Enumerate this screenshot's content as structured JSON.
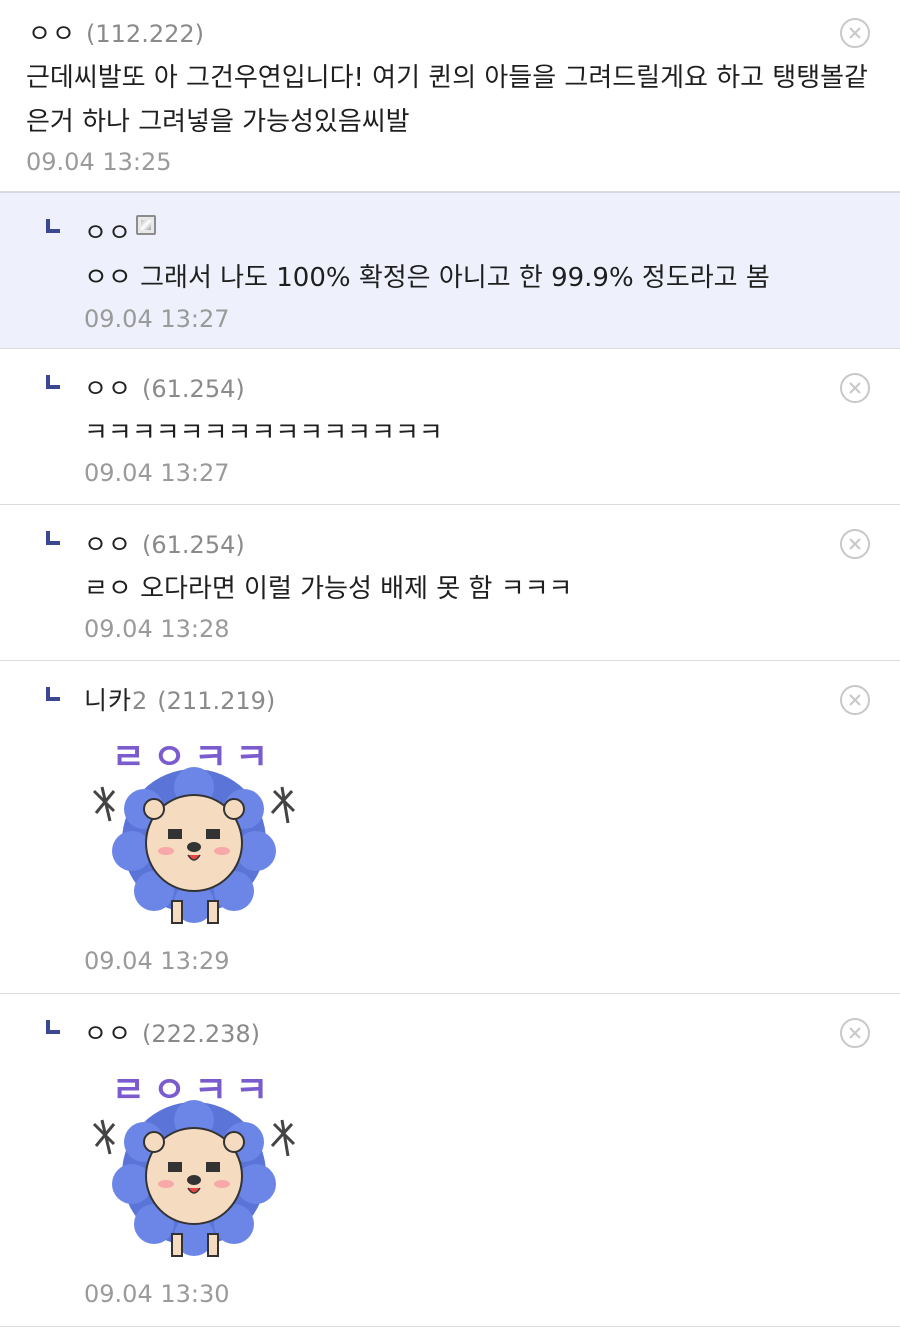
{
  "comments": [
    {
      "nick": "ㅇㅇ",
      "ip": "(112.222)",
      "text_line1": "근데씨발또 아 그건우연입니다! 여기 퀸의 아들을 그려드릴게요 하고 탱탱볼같",
      "text_line2": "은거 하나 그려넣을 가능성있음씨발",
      "time": "09.04 13:25",
      "delete_icon": "close-circle-icon"
    },
    {
      "nick": "ㅇㅇ",
      "badge_icon": "fixed-nick-badge-icon",
      "text": "ㅇㅇ 그래서 나도 100% 확정은 아니고 한 99.9% 정도라고 봄",
      "time": "09.04 13:27",
      "highlight_color": "#eef1fb"
    },
    {
      "nick": "ㅇㅇ",
      "ip": "(61.254)",
      "text": "ㅋㅋㅋㅋㅋㅋㅋㅋㅋㅋㅋㅋㅋㅋㅋ",
      "time": "09.04 13:27",
      "delete_icon": "close-circle-icon"
    },
    {
      "nick": "ㅇㅇ",
      "ip": "(61.254)",
      "text": "ㄹㅇ 오다라면 이럴 가능성 배제 못 함 ㅋㅋㅋ",
      "time": "09.04 13:28",
      "delete_icon": "close-circle-icon"
    },
    {
      "nick": "니카",
      "nick_suffix": "2",
      "ip": "(211.219)",
      "sticker_text": "ㄹㅇㅋㅋ",
      "sticker_icon": "lion-sticker",
      "time": "09.04 13:29",
      "delete_icon": "close-circle-icon"
    },
    {
      "nick": "ㅇㅇ",
      "ip": "(222.238)",
      "sticker_text": "ㄹㅇㅋㅋ",
      "sticker_icon": "lion-sticker",
      "time": "09.04 13:30",
      "delete_icon": "close-circle-icon"
    }
  ],
  "colors": {
    "reply_arrow": "#3b4890",
    "ip_gray": "#8a8a8a",
    "time_gray": "#9a9a9a",
    "sticker_blue": "#5b74d8",
    "sticker_purple": "#7b5ccf"
  }
}
